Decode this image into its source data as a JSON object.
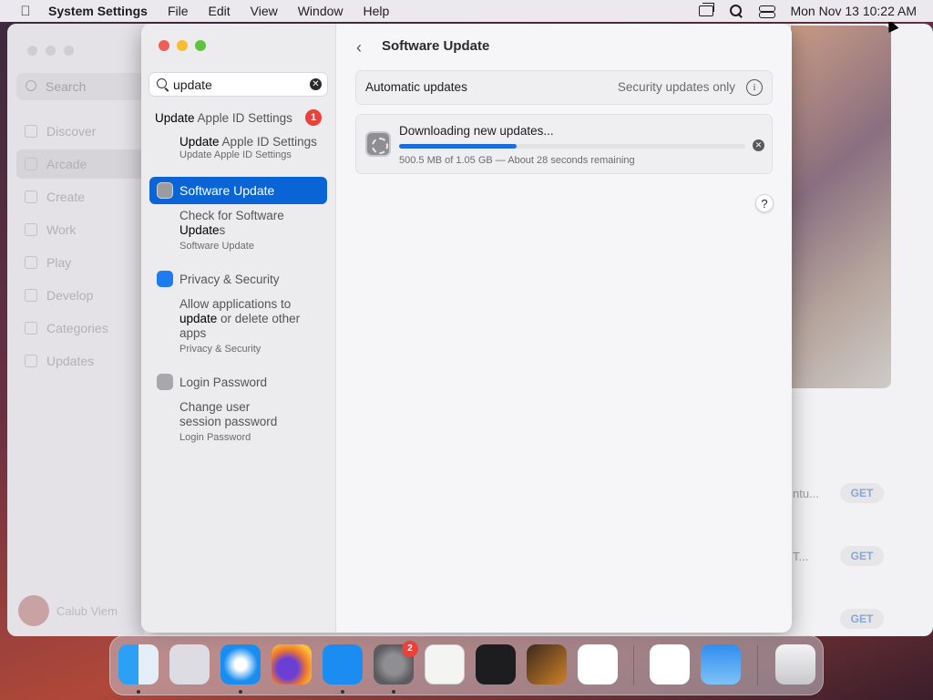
{
  "menubar": {
    "app_name": "System Settings",
    "menus": [
      "File",
      "Edit",
      "View",
      "Window",
      "Help"
    ],
    "datetime": "Mon Nov 13  10:22 AM"
  },
  "background_window": {
    "search_placeholder": "Search",
    "nav": [
      "Discover",
      "Arcade",
      "Create",
      "Work",
      "Play",
      "Develop",
      "Categories",
      "Updates"
    ],
    "user_name": "Calub Viem",
    "rows": [
      {
        "text": "ntu...",
        "button": "GET"
      },
      {
        "text": "T...",
        "button": "GET"
      },
      {
        "text": "",
        "button": "GET"
      }
    ]
  },
  "settings": {
    "search_value": "update",
    "results": [
      {
        "title_match": "Update",
        "title_rest": " Apple ID Settings",
        "badge": "1"
      },
      {
        "title_match": "Update",
        "title_rest": " Apple ID Settings",
        "sub": "Update Apple ID Settings"
      },
      {
        "title_rest": "Software ",
        "title_match": "Update"
      },
      {
        "line1": "Check for Software",
        "line2_match": "Update",
        "line2_rest": "s",
        "sub": "Software Update"
      },
      {
        "title": "Privacy & Security"
      },
      {
        "line1": "Allow applications to",
        "line2_match": "update",
        "line2_rest": " or delete other",
        "line3": "apps",
        "sub": "Privacy & Security"
      },
      {
        "title": "Login Password"
      },
      {
        "line1": "Change user",
        "line2": "session password",
        "sub": "Login Password"
      }
    ],
    "page_title": "Software Update",
    "auto_updates_label": "Automatic updates",
    "auto_updates_value": "Security updates only",
    "download_title": "Downloading new updates...",
    "download_progress": 0.34,
    "download_status": "500.5 MB of 1.05 GB — About 28 seconds remaining",
    "help_label": "?"
  },
  "dock": {
    "apps": [
      "Finder",
      "Launchpad",
      "Safari",
      "Firefox",
      "App Store",
      "System Settings",
      "TextEdit",
      "Terminal",
      "GarageBand",
      "Visual Studio Code",
      "Visual Studio",
      "Weather",
      "Trash"
    ],
    "settings_badge": "2"
  }
}
